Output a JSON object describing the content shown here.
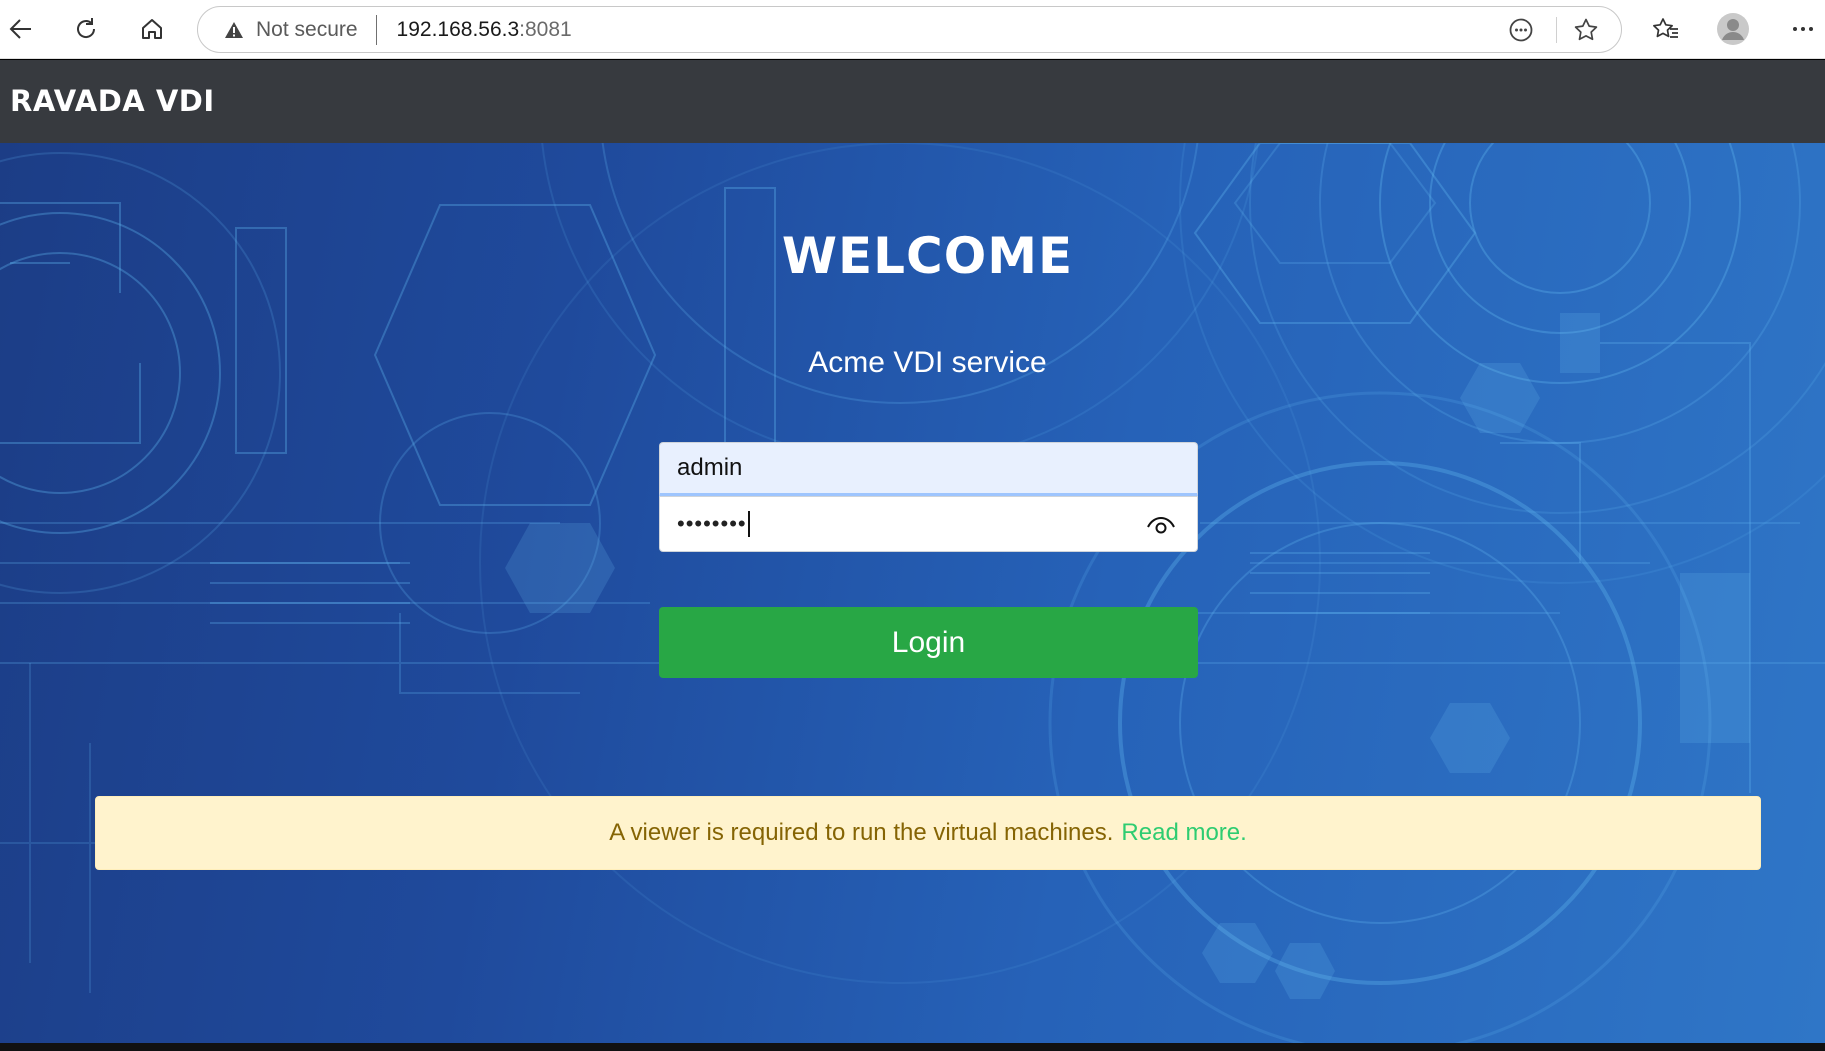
{
  "browser": {
    "security_label": "Not secure",
    "url_host": "192.168.56.3",
    "url_port": ":8081",
    "icons": [
      "back-arrow-icon",
      "refresh-icon",
      "home-icon",
      "warning-icon",
      "reader-icon",
      "star-icon",
      "favorites-icon",
      "profile-icon",
      "more-icon"
    ]
  },
  "header": {
    "brand": "RAVADA VDI",
    "background_color": "#373a3f"
  },
  "login": {
    "title": "WELCOME",
    "service_name": "Acme VDI service",
    "username_value": "admin",
    "password_masked": "••••••••",
    "login_label": "Login",
    "login_color": "#28a745"
  },
  "notice": {
    "text": "A viewer is required to run the virtual machines.",
    "link_text": "Read more.",
    "background_color": "#fff3cd",
    "text_color": "#856404",
    "link_color": "#2ecc71"
  }
}
